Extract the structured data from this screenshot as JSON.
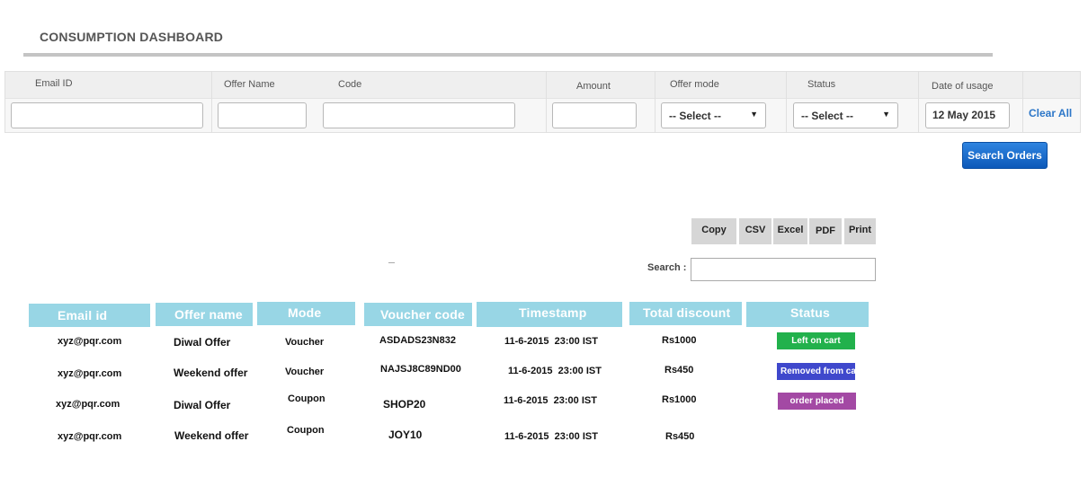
{
  "page": {
    "title": "CONSUMPTION DASHBOARD"
  },
  "filters": {
    "email": {
      "label": "Email ID",
      "value": ""
    },
    "offer_name": {
      "label": "Offer Name",
      "value": ""
    },
    "code": {
      "label": "Code",
      "value": ""
    },
    "amount": {
      "label": "Amount",
      "value": ""
    },
    "offer_mode": {
      "label": "Offer mode",
      "selected": "-- Select --"
    },
    "status": {
      "label": "Status",
      "selected": "-- Select --"
    },
    "date": {
      "label": "Date of usage",
      "value": "12 May 2015"
    },
    "clear_all": "Clear All"
  },
  "search_orders": "Search Orders",
  "export": {
    "copy": "Copy",
    "csv": "CSV",
    "excel": "Excel",
    "pdf": "PDF",
    "print": "Print"
  },
  "table_search": {
    "label": "Search :",
    "value": ""
  },
  "table": {
    "headers": [
      "Email id",
      "Offer name",
      "Mode",
      "Voucher code",
      "Timestamp",
      "Total discount",
      "Status"
    ],
    "rows": [
      {
        "email": "xyz@pqr.com",
        "offer": "Diwal Offer",
        "mode": "Voucher",
        "code": "ASDADS23N832",
        "timestamp": "11-6-2015  23:00 IST",
        "discount": "Rs1000",
        "status": "Left on cart"
      },
      {
        "email": "xyz@pqr.com",
        "offer": "Weekend offer",
        "mode": "Voucher",
        "code": "NAJSJ8C89ND00",
        "timestamp": "11-6-2015  23:00 IST",
        "discount": "Rs450",
        "status": "Removed from cart"
      },
      {
        "email": "xyz@pqr.com",
        "offer": "Diwal Offer",
        "mode": "Coupon",
        "code": "SHOP20",
        "timestamp": "11-6-2015  23:00 IST",
        "discount": "Rs1000",
        "status": "order placed"
      },
      {
        "email": "xyz@pqr.com",
        "offer": "Weekend offer",
        "mode": "Coupon",
        "code": "JOY10",
        "timestamp": "11-6-2015  23:00 IST",
        "discount": "Rs450",
        "status": ""
      }
    ]
  },
  "colors": {
    "header_bg": "#98d6e5",
    "status_left_on_cart": "#22b14c",
    "status_removed": "#3f48cc",
    "status_order_placed": "#a349a4",
    "primary_button": "#1a6fd1"
  }
}
